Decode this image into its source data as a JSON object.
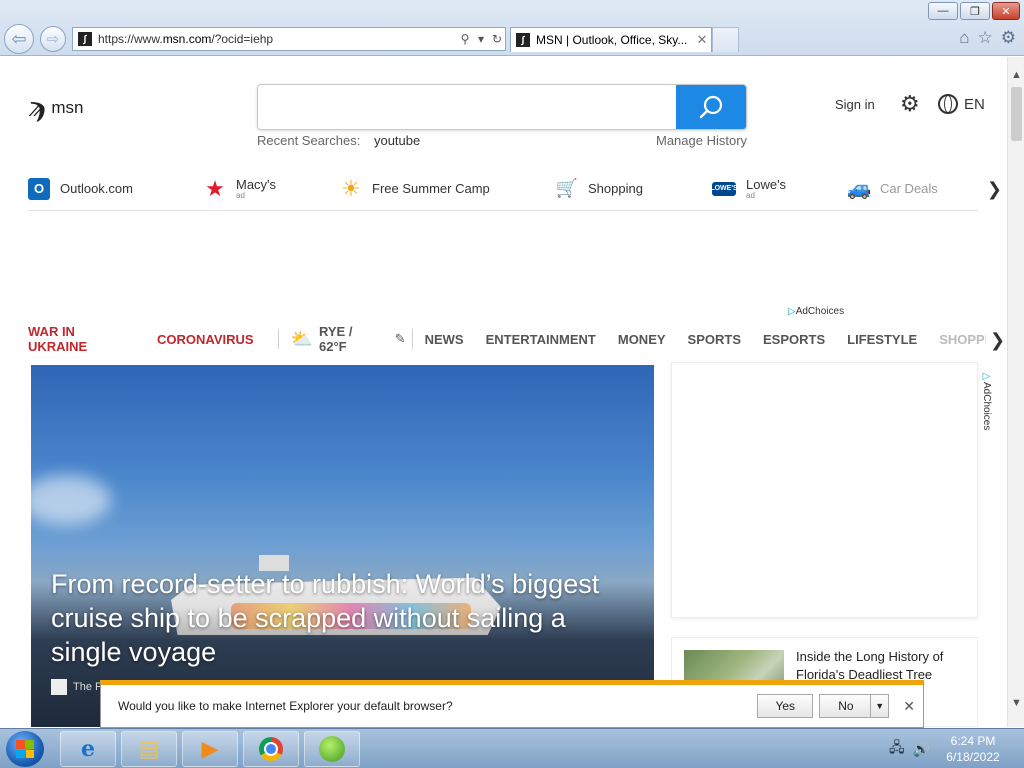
{
  "browser": {
    "url_prefix": "https://www.",
    "url_domain": "msn.com",
    "url_suffix": "/?ocid=iehp",
    "tab_title": "MSN | Outlook, Office, Sky...",
    "window_buttons": {
      "minimize": "—",
      "restore": "❐",
      "close": "✕"
    }
  },
  "header": {
    "logo_text": "msn",
    "search_placeholder": "",
    "recent_label": "Recent Searches:",
    "recent_query": "youtube",
    "manage_history": "Manage History",
    "sign_in": "Sign in",
    "language": "EN"
  },
  "quick_links": [
    {
      "label": "Outlook.com",
      "ad": "",
      "icon": "outlook-icon",
      "color": "#0f6cbd"
    },
    {
      "label": "Macy's",
      "ad": "ad",
      "icon": "macys-star-icon",
      "color": "#e21a2c"
    },
    {
      "label": "Free Summer Camp",
      "ad": "",
      "icon": "sun-icon",
      "color": "#f7a21b"
    },
    {
      "label": "Shopping",
      "ad": "",
      "icon": "cart-icon",
      "color": "#1565c0"
    },
    {
      "label": "Lowe's",
      "ad": "ad",
      "icon": "lowes-icon",
      "color": "#004990"
    },
    {
      "label": "Car Deals",
      "ad": "",
      "icon": "car-icon",
      "color": "#2f73b8"
    }
  ],
  "adchoices": "AdChoices",
  "topnav": {
    "war": "WAR IN UKRAINE",
    "corona": "CORONAVIRUS",
    "weather": "RYE / 62°F",
    "categories": [
      "NEWS",
      "ENTERTAINMENT",
      "MONEY",
      "SPORTS",
      "ESPORTS",
      "LIFESTYLE",
      "SHOPPING"
    ]
  },
  "hero": {
    "title": "From record-setter to rubbish: World’s biggest cruise ship to be scrapped without sailing a single voyage",
    "source": "The P"
  },
  "side_card": {
    "title": "Inside the Long History of Florida's Deadliest Tree"
  },
  "notification": {
    "message": "Would you like to make Internet Explorer your default browser?",
    "yes": "Yes",
    "no": "No"
  },
  "taskbar": {
    "time": "6:24 PM",
    "date": "6/18/2022"
  },
  "colors": {
    "accent": "#1e88e5",
    "news_red": "#c0272d",
    "notify_bar": "#f0a30a"
  }
}
